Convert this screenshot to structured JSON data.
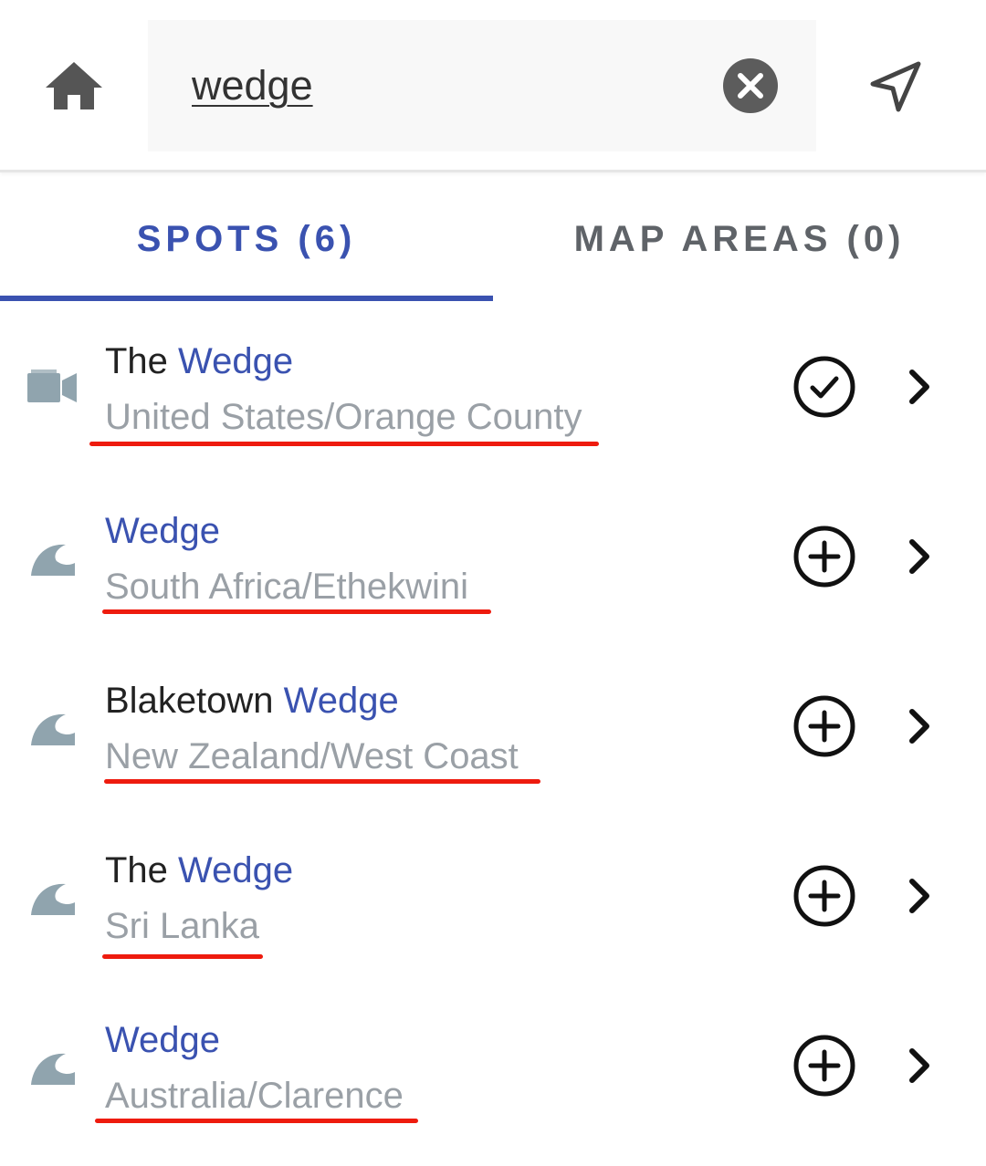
{
  "search": {
    "query": "wedge"
  },
  "tabs": [
    {
      "label": "SPOTS (6)",
      "active": true
    },
    {
      "label": "MAP AREAS (0)",
      "active": false
    }
  ],
  "spots": [
    {
      "title_prefix": "The ",
      "title_match": "Wedge",
      "location": "United States/Orange County",
      "icon": "camera-icon",
      "action": "check-circle-icon"
    },
    {
      "title_prefix": "",
      "title_match": "Wedge",
      "location": "South Africa/Ethekwini",
      "icon": "wave-icon",
      "action": "add-circle-icon"
    },
    {
      "title_prefix": "Blaketown ",
      "title_match": "Wedge",
      "location": "New Zealand/West Coast",
      "icon": "wave-icon",
      "action": "add-circle-icon"
    },
    {
      "title_prefix": "The ",
      "title_match": "Wedge",
      "location": "Sri Lanka",
      "icon": "wave-icon",
      "action": "add-circle-icon"
    },
    {
      "title_prefix": "",
      "title_match": "Wedge",
      "location": "Australia/Clarence",
      "icon": "wave-icon",
      "action": "add-circle-icon"
    }
  ],
  "colors": {
    "accent": "#3a52b0",
    "annotation": "#ee1b0e",
    "subtext": "#9aa0a6"
  }
}
